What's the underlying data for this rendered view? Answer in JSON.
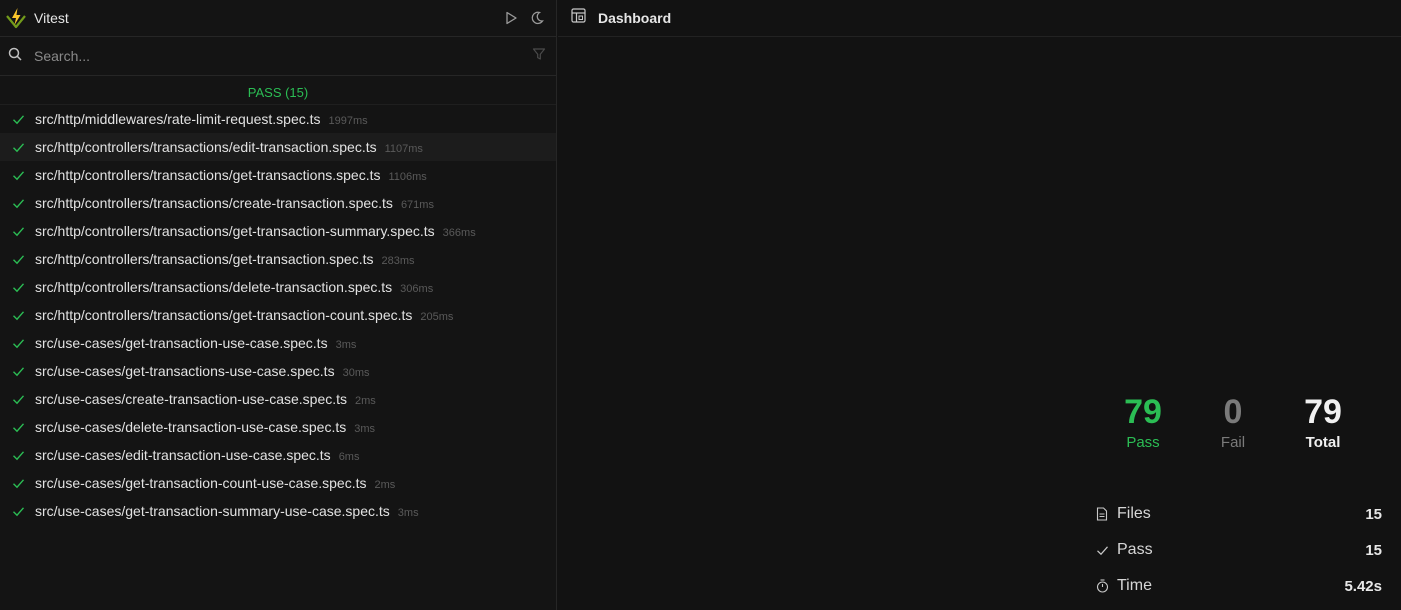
{
  "app": {
    "title": "Vitest"
  },
  "search": {
    "placeholder": "Search..."
  },
  "results": {
    "header": "PASS (15)",
    "items": [
      {
        "name": "src/http/middlewares/rate-limit-request.spec.ts",
        "duration": "1997ms"
      },
      {
        "name": "src/http/controllers/transactions/edit-transaction.spec.ts",
        "duration": "1107ms"
      },
      {
        "name": "src/http/controllers/transactions/get-transactions.spec.ts",
        "duration": "1106ms"
      },
      {
        "name": "src/http/controllers/transactions/create-transaction.spec.ts",
        "duration": "671ms"
      },
      {
        "name": "src/http/controllers/transactions/get-transaction-summary.spec.ts",
        "duration": "366ms"
      },
      {
        "name": "src/http/controllers/transactions/get-transaction.spec.ts",
        "duration": "283ms"
      },
      {
        "name": "src/http/controllers/transactions/delete-transaction.spec.ts",
        "duration": "306ms"
      },
      {
        "name": "src/http/controllers/transactions/get-transaction-count.spec.ts",
        "duration": "205ms"
      },
      {
        "name": "src/use-cases/get-transaction-use-case.spec.ts",
        "duration": "3ms"
      },
      {
        "name": "src/use-cases/get-transactions-use-case.spec.ts",
        "duration": "30ms"
      },
      {
        "name": "src/use-cases/create-transaction-use-case.spec.ts",
        "duration": "2ms"
      },
      {
        "name": "src/use-cases/delete-transaction-use-case.spec.ts",
        "duration": "3ms"
      },
      {
        "name": "src/use-cases/edit-transaction-use-case.spec.ts",
        "duration": "6ms"
      },
      {
        "name": "src/use-cases/get-transaction-count-use-case.spec.ts",
        "duration": "2ms"
      },
      {
        "name": "src/use-cases/get-transaction-summary-use-case.spec.ts",
        "duration": "3ms"
      }
    ]
  },
  "dashboard": {
    "title": "Dashboard",
    "stats": {
      "pass": {
        "value": "79",
        "label": "Pass"
      },
      "fail": {
        "value": "0",
        "label": "Fail"
      },
      "total": {
        "value": "79",
        "label": "Total"
      }
    },
    "summary": {
      "files": {
        "label": "Files",
        "value": "15"
      },
      "pass": {
        "label": "Pass",
        "value": "15"
      },
      "time": {
        "label": "Time",
        "value": "5.42s"
      }
    }
  },
  "colors": {
    "pass": "#2bbd54",
    "fail": "#7a7a7a"
  }
}
